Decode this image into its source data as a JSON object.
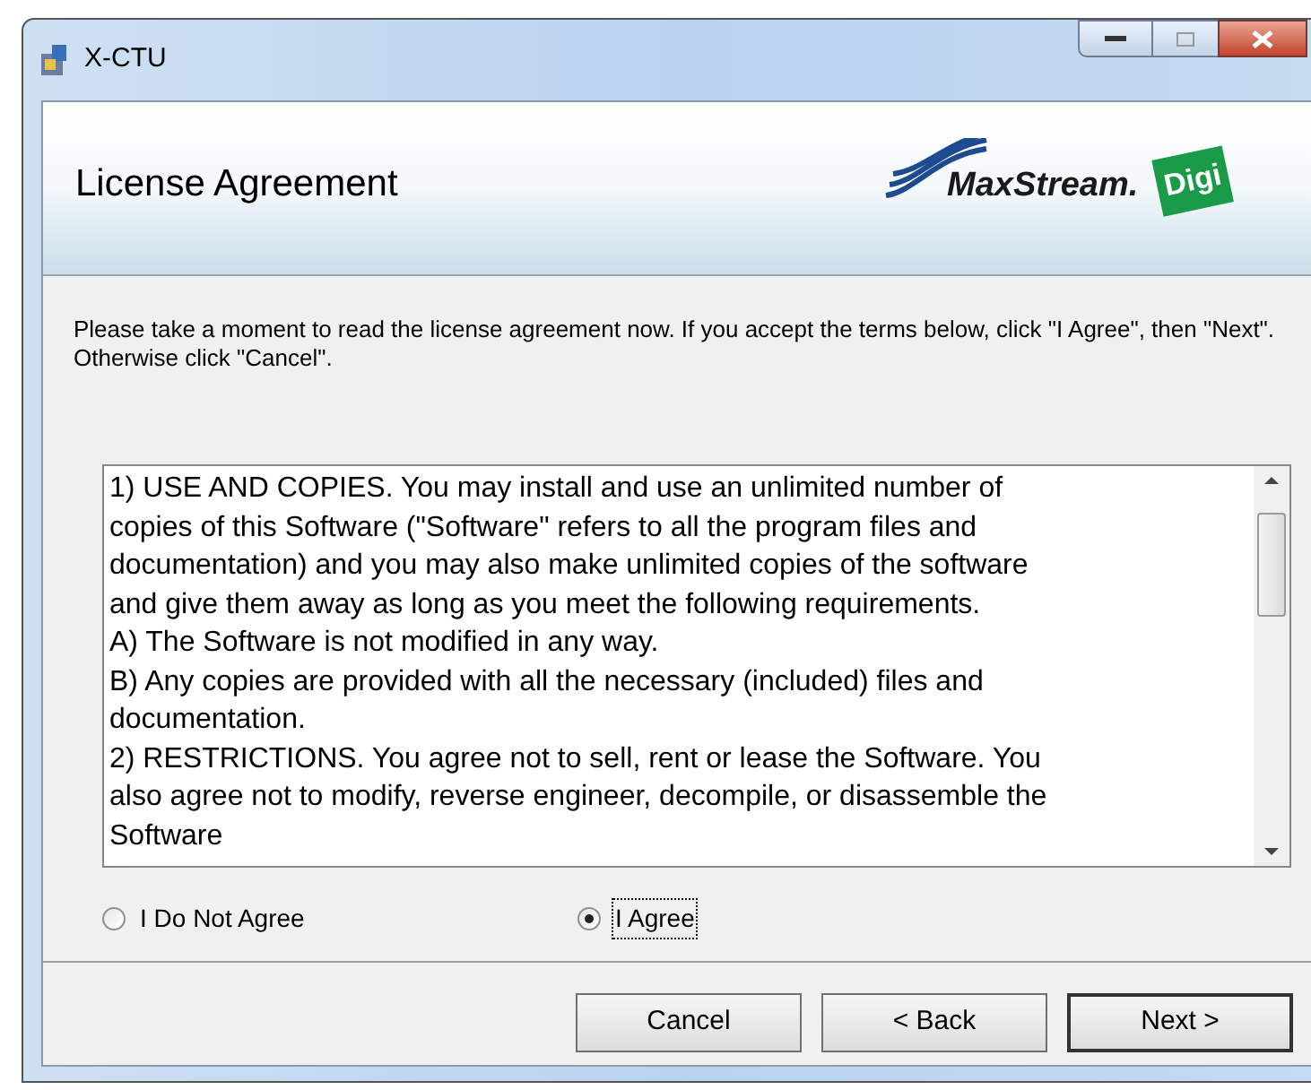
{
  "window": {
    "title": "X-CTU"
  },
  "header": {
    "title": "License Agreement",
    "logo_text": "MaxStream",
    "logo_mark": ".",
    "badge_text": "Digi"
  },
  "intro": "Please take a moment to read the license agreement now. If you accept the terms below, click \"I Agree\", then \"Next\". Otherwise click \"Cancel\".",
  "license_lines": [
    "1) USE AND COPIES. You may install and use an unlimited number of",
    "copies of this Software (\"Software\" refers to all the program files and",
    "documentation) and you may also make unlimited copies of the software",
    "and give them away as long as you meet the following requirements.",
    "A) The Software is not modified in any way.",
    "B) Any copies are provided with all the necessary (included) files and",
    "documentation.",
    "2) RESTRICTIONS. You agree not to sell, rent or lease the Software.  You",
    "also agree not to modify, reverse engineer, decompile, or disassemble the",
    "Software"
  ],
  "options": [
    {
      "label": "I Do Not Agree",
      "selected": false
    },
    {
      "label": "I Agree",
      "selected": true
    }
  ],
  "buttons": [
    {
      "label": "Cancel",
      "kind": "cancel"
    },
    {
      "label": "< Back",
      "kind": "back"
    },
    {
      "label": "Next >",
      "kind": "next"
    }
  ]
}
